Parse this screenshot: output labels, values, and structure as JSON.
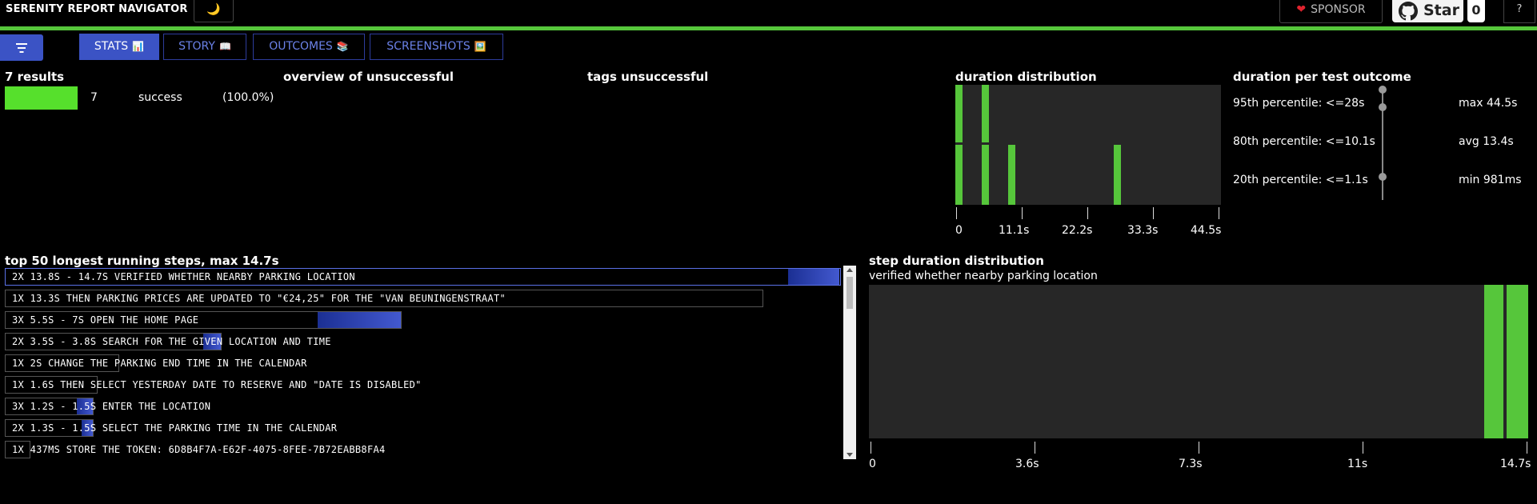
{
  "header": {
    "title": "SERENITY REPORT NAVIGATOR",
    "theme_icon": "🌙",
    "sponsor_label": "SPONSOR",
    "star_label": "Star",
    "star_count": "0",
    "help_label": "?"
  },
  "tabs": [
    {
      "label": "STATS",
      "emoji": "📊",
      "active": true
    },
    {
      "label": "STORY",
      "emoji": "📖",
      "active": false
    },
    {
      "label": "OUTCOMES",
      "emoji": "📚",
      "active": false
    },
    {
      "label": "SCREENSHOTS",
      "emoji": "🖼️",
      "active": false
    }
  ],
  "results": {
    "heading": "7 results",
    "count": "7",
    "status": "success",
    "percent": "(100.0%)",
    "bar_color": "#56e02c"
  },
  "overview_heading": "overview of unsuccessful",
  "tags_heading": "tags unsuccessful",
  "duration_distribution": {
    "heading": "duration distribution",
    "tick_labels": [
      "0",
      "11.1s",
      "22.2s",
      "33.3s",
      "44.5s"
    ]
  },
  "duration_outcome": {
    "heading": "duration per test outcome",
    "p95": "95th percentile: <=28s",
    "p80": "80th percentile: <=10.1s",
    "p20": "20th percentile: <=1.1s",
    "max": "max 44.5s",
    "avg": "avg 13.4s",
    "min": "min 981ms"
  },
  "steps": {
    "heading": "top 50 longest running steps, max 14.7s",
    "items": [
      {
        "text": "2X 13.8S - 14.7S VERIFIED WHETHER NEARBY PARKING LOCATION",
        "min_fraction": 0.939,
        "max_fraction": 1.0,
        "selected": true
      },
      {
        "text": "1X 13.3S THEN PARKING PRICES ARE UPDATED TO \"€24,25\" FOR THE \"VAN BEUNINGENSTRAAT\"",
        "min_fraction": 0.905,
        "max_fraction": 0.905,
        "selected": false
      },
      {
        "text": "3X 5.5S - 7S OPEN THE HOME PAGE",
        "min_fraction": 0.374,
        "max_fraction": 0.476,
        "selected": false
      },
      {
        "text": "2X 3.5S - 3.8S SEARCH FOR THE GIVEN LOCATION AND TIME",
        "min_fraction": 0.238,
        "max_fraction": 0.259,
        "selected": false
      },
      {
        "text": "1X 2S CHANGE THE PARKING END TIME IN THE CALENDAR",
        "min_fraction": 0.136,
        "max_fraction": 0.136,
        "selected": false
      },
      {
        "text": "1X 1.6S THEN SELECT YESTERDAY DATE TO RESERVE AND \"DATE IS DISABLED\"",
        "min_fraction": 0.109,
        "max_fraction": 0.109,
        "selected": false
      },
      {
        "text": "3X 1.2S - 1.5S ENTER THE LOCATION",
        "min_fraction": 0.082,
        "max_fraction": 0.102,
        "selected": false
      },
      {
        "text": "2X 1.3S - 1.5S SELECT THE PARKING TIME IN THE CALENDAR",
        "min_fraction": 0.088,
        "max_fraction": 0.102,
        "selected": false
      },
      {
        "text": "1X 437MS STORE THE TOKEN: 6D8B4F7A-E62F-4075-8FEE-7B72EABB8FA4",
        "min_fraction": 0.03,
        "max_fraction": 0.03,
        "selected": false
      }
    ]
  },
  "step_duration": {
    "heading": "step duration distribution",
    "subtitle": "verified whether nearby parking location",
    "tick_labels": [
      "0",
      "3.6s",
      "7.3s",
      "11s",
      "14.7s"
    ]
  },
  "colors": {
    "accent": "#3b53c5",
    "success": "#56c63b",
    "panel": "#272727"
  }
}
